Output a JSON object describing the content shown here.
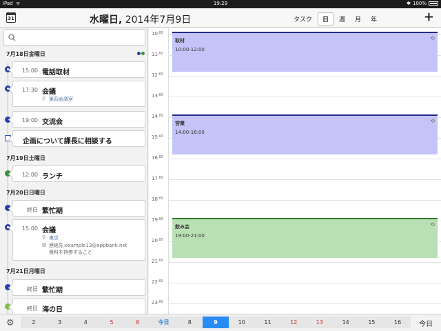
{
  "status": {
    "time": "19:29",
    "battery": "100%"
  },
  "header": {
    "title_weekday": "水曜日,",
    "title_date": " 2014年7月9日",
    "calendar_icon_day": "31",
    "views": [
      "タスク",
      "日",
      "週",
      "月",
      "年"
    ],
    "active_view": "日",
    "add_label": "+"
  },
  "agenda": {
    "days": [
      {
        "label": "7月18日金曜日",
        "items": [
          {
            "kind": "event",
            "marker": "clock",
            "color": "#2c3ea8",
            "time": "15:00",
            "title": "電話取材"
          },
          {
            "kind": "event",
            "marker": "place",
            "color": "#2c3ea8",
            "time": "17:30",
            "title": "会議",
            "location": "第四会議室"
          },
          {
            "kind": "event",
            "marker": "dot",
            "color": "#2c3ea8",
            "time": "19:00",
            "title": "交流会"
          },
          {
            "kind": "task",
            "title": "企画について課長に相談する"
          }
        ]
      },
      {
        "label": "7月19日土曜日",
        "items": [
          {
            "kind": "event",
            "marker": "dot",
            "color": "#3a8f3a",
            "time": "12:00",
            "title": "ランチ"
          }
        ]
      },
      {
        "label": "7月20日日曜日",
        "items": [
          {
            "kind": "event",
            "marker": "dot",
            "color": "#2c3ea8",
            "time": "終日",
            "title": "繁忙期"
          },
          {
            "kind": "event",
            "marker": "place",
            "color": "#2c3ea8",
            "time": "15:00",
            "title": "会議",
            "location": "東京",
            "note_line1": "連絡先:example13@appbank.net",
            "note_line2": "資料を持参すること"
          }
        ]
      },
      {
        "label": "7月21日月曜日",
        "items": [
          {
            "kind": "event",
            "marker": "dot",
            "color": "#2c3ea8",
            "time": "終日",
            "title": "繁忙期"
          },
          {
            "kind": "event",
            "marker": "dot",
            "color": "#7bc043",
            "time": "終日",
            "title": "海の日"
          }
        ]
      }
    ]
  },
  "day_view": {
    "hours": [
      "10",
      "11",
      "12",
      "13",
      "14",
      "15",
      "16",
      "17",
      "18",
      "19",
      "20",
      "21",
      "22",
      "23"
    ],
    "minute_suffix": ":00",
    "events": [
      {
        "title": "取材",
        "time": "10:00-12:00",
        "start": 10,
        "end": 12,
        "fill": "#c4c4fa",
        "border": "#222a8a"
      },
      {
        "title": "営業",
        "time": "14:00-16:00",
        "start": 14,
        "end": 16,
        "fill": "#c4c4fa",
        "border": "#222a8a"
      },
      {
        "title": "飲み会",
        "time": "19:00-21:00",
        "start": 19,
        "end": 21,
        "fill": "#b9e0b4",
        "border": "#2f7d2f"
      }
    ]
  },
  "bottom": {
    "days": [
      {
        "label": "2",
        "style": ""
      },
      {
        "label": "3",
        "style": ""
      },
      {
        "label": "4",
        "style": ""
      },
      {
        "label": "5",
        "style": "red"
      },
      {
        "label": "6",
        "style": "red"
      },
      {
        "label": "今日",
        "style": "blue"
      },
      {
        "label": "8",
        "style": ""
      },
      {
        "label": "9",
        "style": "selected"
      },
      {
        "label": "10",
        "style": ""
      },
      {
        "label": "11",
        "style": ""
      },
      {
        "label": "12",
        "style": "red"
      },
      {
        "label": "13",
        "style": "red"
      },
      {
        "label": "14",
        "style": ""
      },
      {
        "label": "15",
        "style": ""
      },
      {
        "label": "16",
        "style": ""
      }
    ],
    "today_label": "今日"
  }
}
